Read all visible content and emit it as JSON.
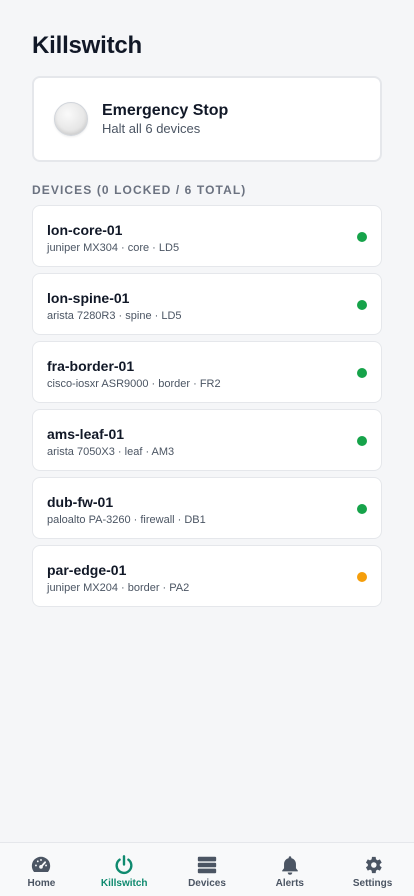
{
  "header": {
    "title": "Killswitch"
  },
  "emergency": {
    "title": "Emergency Stop",
    "subtitle": "Halt all 6 devices"
  },
  "devices_section": {
    "label": "DEVICES (0 LOCKED / 6 TOTAL)"
  },
  "devices": [
    {
      "name": "lon-core-01",
      "meta": "juniper MX304 · core · LD5",
      "status_color": "#16a34a"
    },
    {
      "name": "lon-spine-01",
      "meta": "arista 7280R3 · spine · LD5",
      "status_color": "#16a34a"
    },
    {
      "name": "fra-border-01",
      "meta": "cisco-iosxr ASR9000 · border · FR2",
      "status_color": "#16a34a"
    },
    {
      "name": "ams-leaf-01",
      "meta": "arista 7050X3 · leaf · AM3",
      "status_color": "#16a34a"
    },
    {
      "name": "dub-fw-01",
      "meta": "paloalto PA-3260 · firewall · DB1",
      "status_color": "#16a34a"
    },
    {
      "name": "par-edge-01",
      "meta": "juniper MX204 · border · PA2",
      "status_color": "#f59e0b"
    }
  ],
  "tabs": [
    {
      "label": "Home",
      "icon": "gauge-icon",
      "active": false
    },
    {
      "label": "Killswitch",
      "icon": "power-icon",
      "active": true
    },
    {
      "label": "Devices",
      "icon": "server-icon",
      "active": false
    },
    {
      "label": "Alerts",
      "icon": "bell-icon",
      "active": false
    },
    {
      "label": "Settings",
      "icon": "gear-icon",
      "active": false
    }
  ],
  "colors": {
    "active_tab": "#0f8a6f",
    "inactive_tab": "#4b5563"
  }
}
